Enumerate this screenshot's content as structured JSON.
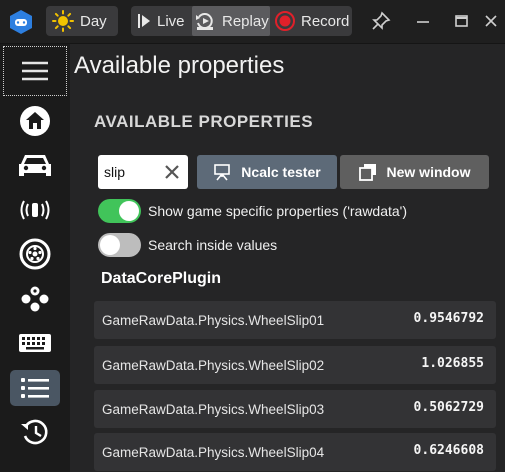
{
  "toolbar": {
    "mode_label": "Day",
    "live_label": "Live",
    "replay_label": "Replay",
    "record_label": "Record"
  },
  "page": {
    "title": "Available properties",
    "section_title": "AVAILABLE PROPERTIES"
  },
  "search": {
    "value": "slip"
  },
  "buttons": {
    "ncalc_label": "Ncalc tester",
    "new_window_label": "New window"
  },
  "toggles": [
    {
      "label": "Show game specific properties ('rawdata')",
      "on": true
    },
    {
      "label": "Search inside values",
      "on": false
    }
  ],
  "plugin": {
    "title": "DataCorePlugin",
    "properties": [
      {
        "name": "GameRawData.Physics.WheelSlip01",
        "value": "0.9546792"
      },
      {
        "name": "GameRawData.Physics.WheelSlip02",
        "value": "1.026855"
      },
      {
        "name": "GameRawData.Physics.WheelSlip03",
        "value": "0.5062729"
      },
      {
        "name": "GameRawData.Physics.WheelSlip04",
        "value": "0.6246608"
      }
    ]
  },
  "sidebar": {
    "items": [
      {
        "icon": "home-icon"
      },
      {
        "icon": "car-icon"
      },
      {
        "icon": "vibration-icon"
      },
      {
        "icon": "wheel-icon"
      },
      {
        "icon": "gamepad-icon"
      },
      {
        "icon": "keyboard-icon"
      },
      {
        "icon": "list-icon",
        "active": true
      },
      {
        "icon": "history-icon"
      }
    ]
  },
  "colors": {
    "accent_blue": "#5d6a78",
    "toggle_on": "#41c45a",
    "record_red": "#e0202a",
    "logo_blue": "#2d7fe0"
  }
}
